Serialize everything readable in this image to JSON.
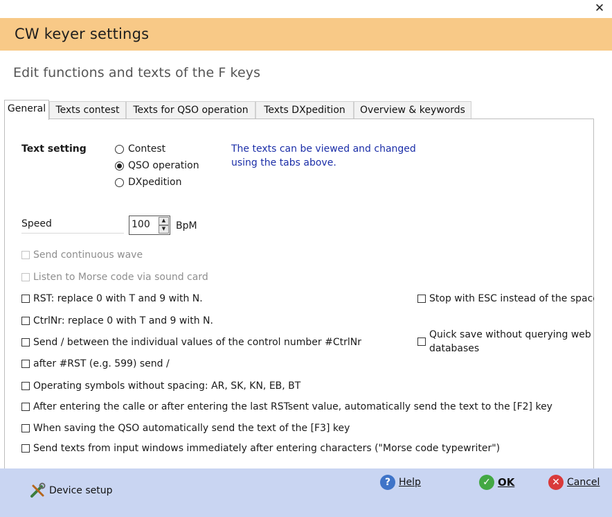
{
  "window": {
    "close_glyph": "✕",
    "title": "CW keyer settings",
    "subtitle": "Edit functions and texts of the F keys"
  },
  "tabs": [
    {
      "label": "General",
      "active": true
    },
    {
      "label": "Texts contest",
      "active": false
    },
    {
      "label": "Texts for QSO operation",
      "active": false
    },
    {
      "label": "Texts DXpedition",
      "active": false
    },
    {
      "label": "Overview & keywords",
      "active": false
    }
  ],
  "text_setting": {
    "label": "Text setting",
    "options": [
      {
        "label": "Contest",
        "selected": false
      },
      {
        "label": "QSO operation",
        "selected": true
      },
      {
        "label": "DXpedition",
        "selected": false
      }
    ],
    "note_line1": "The texts can be viewed and changed",
    "note_line2": "using the tabs above."
  },
  "speed": {
    "label": "Speed",
    "value": "100",
    "unit": "BpM"
  },
  "options": {
    "continuous_wave": "Send continuous wave",
    "sound_card": "Listen to Morse code via sound card",
    "rst_replace": "RST: replace 0 with T and 9 with N.",
    "ctrlnr_replace": "CtrlNr: replace 0 with T and 9 with N.",
    "send_slash": "Send / between the individual values of the control number #CtrlNr",
    "after_rst": "after #RST (e.g. 599) send /",
    "operating_symbols": "Operating symbols without spacing: AR, SK, KN, EB, BT",
    "after_callee": "After entering the calle or after entering the last RSTsent value, automatically send the text to the [F2] key",
    "saving_qso": "When saving the QSO automatically send the text of the [F3] key",
    "send_texts": "Send texts from input windows immediately after entering characters (\"Morse code typewriter\")",
    "stop_esc": "Stop with ESC instead of the space b",
    "quick_save_line1": "Quick save without querying web",
    "quick_save_line2": "databases"
  },
  "footer": {
    "device_setup": "Device setup",
    "help": "Help",
    "ok": "OK",
    "cancel": "Cancel"
  },
  "colors": {
    "title_bar": "#f8c987",
    "footer": "#c9d5f2",
    "note_text": "#1b2ea8",
    "help_icon": "#3f74c8",
    "ok_icon": "#43a843",
    "cancel_icon": "#d93a3a"
  }
}
